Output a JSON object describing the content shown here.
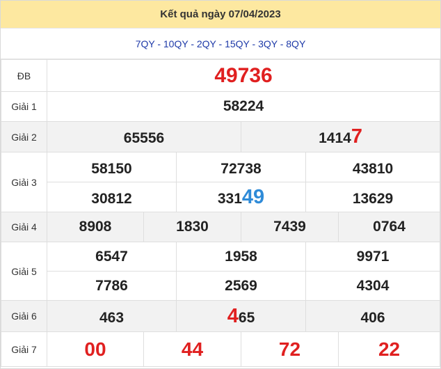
{
  "header": {
    "title": "Kết quả ngày 07/04/2023"
  },
  "codes": "7QY - 10QY - 2QY - 15QY - 3QY - 8QY",
  "prizes": {
    "db": {
      "label": "ĐB",
      "value": "49736"
    },
    "g1": {
      "label": "Giải 1",
      "value": "58224"
    },
    "g2": {
      "label": "Giải 2",
      "values": [
        {
          "plain": "65556",
          "hl": ""
        },
        {
          "plain": "1414",
          "hl": "7"
        }
      ]
    },
    "g3": {
      "label": "Giải 3",
      "values": [
        {
          "plain": "58150",
          "hl": ""
        },
        {
          "plain": "72738",
          "hl": ""
        },
        {
          "plain": "43810",
          "hl": ""
        },
        {
          "plain": "30812",
          "hl": ""
        },
        {
          "plain": "331",
          "hl": "49"
        },
        {
          "plain": "13629",
          "hl": ""
        }
      ]
    },
    "g4": {
      "label": "Giải 4",
      "values": [
        "8908",
        "1830",
        "7439",
        "0764"
      ]
    },
    "g5": {
      "label": "Giải 5",
      "values": [
        "6547",
        "1958",
        "9971",
        "7786",
        "2569",
        "4304"
      ]
    },
    "g6": {
      "label": "Giải 6",
      "values": [
        {
          "pre": "",
          "hl": "",
          "post": "463"
        },
        {
          "pre": "",
          "hl": "4",
          "post": "65"
        },
        {
          "pre": "",
          "hl": "",
          "post": "406"
        }
      ]
    },
    "g7": {
      "label": "Giải 7",
      "values": [
        "00",
        "44",
        "72",
        "22"
      ]
    }
  },
  "colors": {
    "header_bg": "#fde8a0",
    "codes_text": "#1e3aa8",
    "highlight_red": "#e02020",
    "highlight_blue": "#2f8bd8",
    "row_shade": "#f2f2f2"
  }
}
